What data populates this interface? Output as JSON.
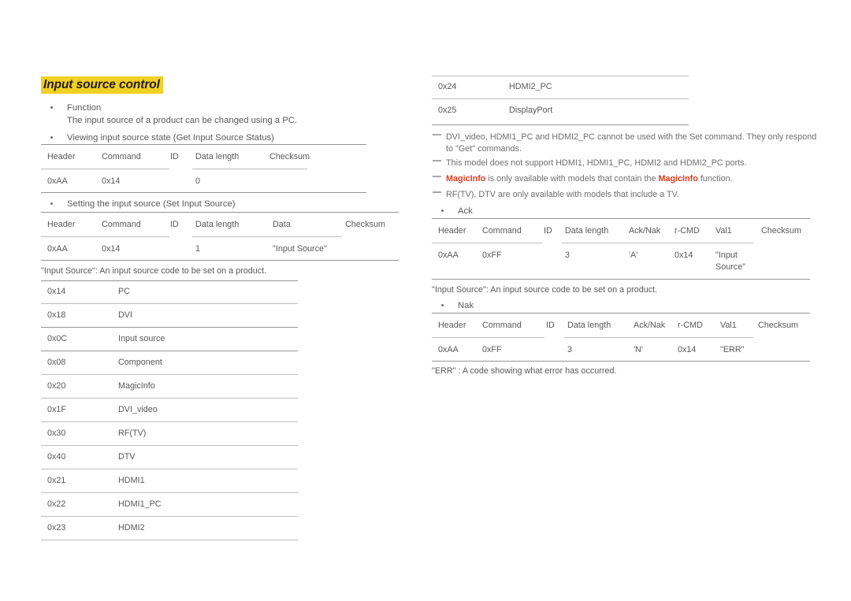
{
  "heading": "Input source control",
  "left": {
    "function_label": "Function",
    "function_desc": "The input source of a product can be changed using a PC.",
    "get_status_label": "Viewing input source state (Get Input Source Status)",
    "get_table": {
      "headers": [
        "Header",
        "Command",
        "ID",
        "Data length",
        "Checksum"
      ],
      "row": [
        "0xAA",
        "0x14",
        "",
        "0",
        ""
      ]
    },
    "set_label": "Setting the input source (Set Input Source)",
    "set_table": {
      "headers": [
        "Header",
        "Command",
        "ID",
        "Data length",
        "Data",
        "Checksum"
      ],
      "row": [
        "0xAA",
        "0x14",
        "",
        "1",
        "\"Input Source\"",
        ""
      ]
    },
    "input_source_caption": "\"Input Source\": An input source code to be set on a product.",
    "code_list": [
      {
        "code": "0x14",
        "name": "PC"
      },
      {
        "code": "0x18",
        "name": "DVI"
      },
      {
        "code": "0x0C",
        "name": "Input source"
      },
      {
        "code": "0x08",
        "name": "Component"
      },
      {
        "code": "0x20",
        "name": "MagicInfo"
      },
      {
        "code": "0x1F",
        "name": "DVI_video"
      },
      {
        "code": "0x30",
        "name": "RF(TV)"
      },
      {
        "code": "0x40",
        "name": "DTV"
      },
      {
        "code": "0x21",
        "name": "HDMI1"
      },
      {
        "code": "0x22",
        "name": "HDMI1_PC"
      },
      {
        "code": "0x23",
        "name": "HDMI2"
      }
    ]
  },
  "right": {
    "code_list": [
      {
        "code": "0x24",
        "name": "HDMI2_PC"
      },
      {
        "code": "0x25",
        "name": "DisplayPort"
      }
    ],
    "notes": [
      {
        "pre": "DVI_video, HDMI1_PC and HDMI2_PC cannot be used with the Set command. They only respond to \"Get\" commands.",
        "hl": "",
        "post": ""
      },
      {
        "pre": "This model does not support HDMI1, HDMI1_PC, HDMI2 and HDMI2_PC ports.",
        "hl": "",
        "post": ""
      },
      {
        "pre": "",
        "hl": "MagicInfo",
        "mid": " is only available with models that contain the ",
        "hl2": "MagicInfo",
        "post": " function."
      },
      {
        "pre": "RF(TV), DTV are only available with models that include a TV.",
        "hl": "",
        "post": ""
      }
    ],
    "ack_label": "Ack",
    "ack_table": {
      "headers": [
        "Header",
        "Command",
        "ID",
        "Data length",
        "Ack/Nak",
        "r-CMD",
        "Val1",
        "Checksum"
      ],
      "row": [
        "0xAA",
        "0xFF",
        "",
        "3",
        "'A'",
        "0x14",
        "\"Input\nSource\"",
        ""
      ]
    },
    "input_source_caption": "\"Input Source\": An input source code to be set on a product.",
    "nak_label": "Nak",
    "nak_table": {
      "headers": [
        "Header",
        "Command",
        "ID",
        "Data length",
        "Ack/Nak",
        "r-CMD",
        "Val1",
        "Checksum"
      ],
      "row": [
        "0xAA",
        "0xFF",
        "",
        "3",
        "'N'",
        "0x14",
        "\"ERR\"",
        ""
      ]
    },
    "err_caption": "\"ERR\" : A code showing what error has occurred."
  },
  "colors": {
    "heading_highlight": "#f2d024",
    "accent_red": "#e03c1f",
    "text": "#58595b",
    "rule": "#a7a9ac"
  }
}
